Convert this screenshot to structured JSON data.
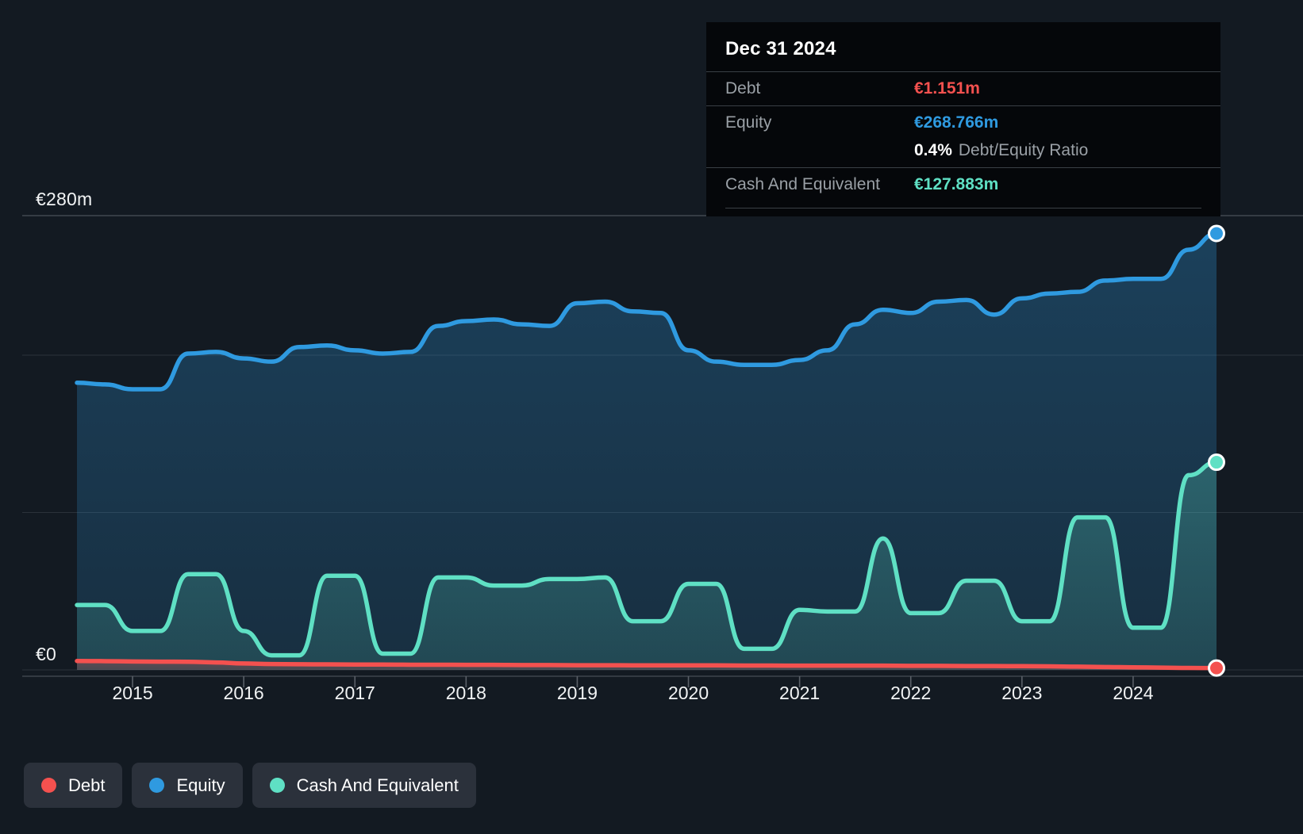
{
  "colors": {
    "background": "#131a22",
    "plot_background": "#131a22",
    "debt": "#f4514f",
    "equity": "#2f9ae0",
    "cash": "#5fe0c4",
    "gridline": "#4a5058",
    "tooltip_background": "#05070a",
    "legend_chip": "#2b313b"
  },
  "tooltip": {
    "title": "Dec 31 2024",
    "rows": [
      {
        "key": "Debt",
        "value": "€1.151m"
      },
      {
        "key": "Equity",
        "value": "€268.766m"
      },
      {
        "key": "Cash And Equivalent",
        "value": "€127.883m"
      }
    ],
    "ratio_value": "0.4%",
    "ratio_label": "Debt/Equity Ratio"
  },
  "legend": {
    "items": [
      {
        "label": "Debt",
        "color": "#f4514f"
      },
      {
        "label": "Equity",
        "color": "#2f9ae0"
      },
      {
        "label": "Cash And Equivalent",
        "color": "#5fe0c4"
      }
    ]
  },
  "axes": {
    "y_top_label": "€280m",
    "y_zero_label": "€0",
    "x_labels": [
      "2015",
      "2016",
      "2017",
      "2018",
      "2019",
      "2020",
      "2021",
      "2022",
      "2023",
      "2024"
    ]
  },
  "chart_data": {
    "type": "area",
    "title": "",
    "subtitle": "",
    "xlabel": "",
    "ylabel": "",
    "currency": "EUR",
    "units": "millions",
    "ylim": [
      0,
      280
    ],
    "y_ticks": [
      0,
      280
    ],
    "y_gridlines": [
      0,
      97,
      194,
      280
    ],
    "grid": true,
    "legend_position": "bottom-left",
    "x_tick_labels": [
      "2015",
      "2016",
      "2017",
      "2018",
      "2019",
      "2020",
      "2021",
      "2022",
      "2023",
      "2024"
    ],
    "x_range": [
      "2014-09-30",
      "2024-12-31"
    ],
    "x": [
      "2014-09",
      "2014-12",
      "2015-03",
      "2015-06",
      "2015-09",
      "2015-12",
      "2016-03",
      "2016-06",
      "2016-09",
      "2016-12",
      "2017-03",
      "2017-06",
      "2017-09",
      "2017-12",
      "2018-03",
      "2018-06",
      "2018-09",
      "2018-12",
      "2019-03",
      "2019-06",
      "2019-09",
      "2019-12",
      "2020-03",
      "2020-06",
      "2020-09",
      "2020-12",
      "2021-03",
      "2021-06",
      "2021-09",
      "2021-12",
      "2022-03",
      "2022-06",
      "2022-09",
      "2022-12",
      "2023-03",
      "2023-06",
      "2023-09",
      "2023-12",
      "2024-03",
      "2024-06",
      "2024-09",
      "2024-12"
    ],
    "series": [
      {
        "name": "Equity",
        "color": "#2f9ae0",
        "fill": "rgba(47,154,224,0.22)",
        "end_value": 268.766,
        "values": [
          177,
          176,
          173,
          173,
          195,
          196,
          192,
          190,
          199,
          200,
          197,
          195,
          196,
          212,
          215,
          216,
          213,
          212,
          226,
          227,
          221,
          220,
          197,
          190,
          188,
          188,
          191,
          197,
          213,
          222,
          220,
          227,
          228,
          219,
          229,
          232,
          233,
          240,
          241,
          241,
          259,
          269
        ]
      },
      {
        "name": "Cash And Equivalent",
        "color": "#5fe0c4",
        "fill": "rgba(95,224,196,0.20)",
        "end_value": 127.883,
        "values": [
          40,
          40,
          24,
          24,
          59,
          59,
          24,
          9,
          9,
          58,
          58,
          10,
          10,
          57,
          57,
          52,
          52,
          56,
          56,
          57,
          30,
          30,
          53,
          53,
          13,
          13,
          37,
          36,
          36,
          81,
          35,
          35,
          55,
          55,
          30,
          30,
          94,
          94,
          26,
          26,
          120,
          128
        ]
      },
      {
        "name": "Debt",
        "color": "#f4514f",
        "fill": "rgba(244,81,79,0.18)",
        "end_value": 1.151,
        "values": [
          5.5,
          5.4,
          5.2,
          5.1,
          5.0,
          4.6,
          4.0,
          3.6,
          3.5,
          3.4,
          3.3,
          3.3,
          3.2,
          3.2,
          3.1,
          3.1,
          3.0,
          3.0,
          2.9,
          2.9,
          2.8,
          2.8,
          2.8,
          2.8,
          2.7,
          2.7,
          2.6,
          2.6,
          2.6,
          2.6,
          2.5,
          2.5,
          2.4,
          2.4,
          2.3,
          2.2,
          2.0,
          1.8,
          1.6,
          1.4,
          1.2,
          1.151
        ]
      }
    ]
  }
}
